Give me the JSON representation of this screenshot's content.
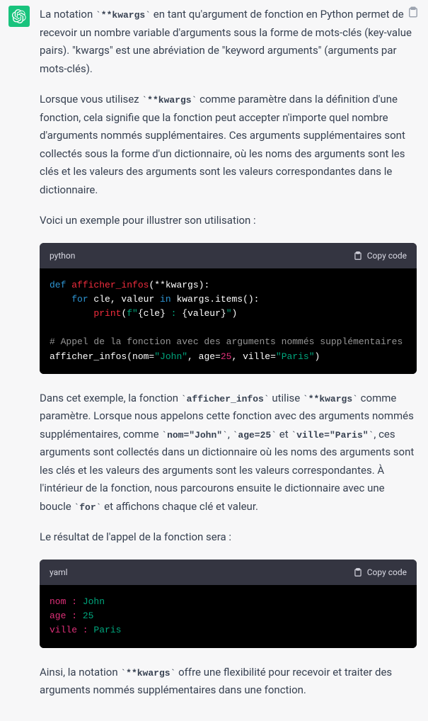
{
  "labels": {
    "lang_python": "python",
    "lang_yaml": "yaml",
    "copy": "Copy code"
  },
  "paragraphs": {
    "p1a": "La notation ",
    "p1c": " en tant qu'argument de fonction en Python permet de recevoir un nombre variable d'arguments sous la forme de mots-clés (key-value pairs). \"kwargs\" est une abréviation de \"keyword arguments\" (arguments par mots-clés).",
    "p2a": "Lorsque vous utilisez ",
    "p2c": " comme paramètre dans la définition d'une fonction, cela signifie que la fonction peut accepter n'importe quel nombre d'arguments nommés supplémentaires. Ces arguments supplémentaires sont collectés sous la forme d'un dictionnaire, où les noms des arguments sont les clés et les valeurs des arguments sont les valeurs correspondantes dans le dictionnaire.",
    "p3": "Voici un exemple pour illustrer son utilisation :",
    "p4a": "Dans cet exemple, la fonction ",
    "p4b": " utilise ",
    "p4c": " comme paramètre. Lorsque nous appelons cette fonction avec des arguments nommés supplémentaires, comme ",
    "p4d": ", ",
    "p4e": " et ",
    "p4f": ", ces arguments sont collectés dans un dictionnaire où les noms des arguments sont les clés et les valeurs des arguments sont les valeurs correspondantes. À l'intérieur de la fonction, nous parcourons ensuite le dictionnaire avec une boucle ",
    "p4g": " et affichons chaque clé et valeur.",
    "p5": "Le résultat de l'appel de la fonction sera :",
    "p6a": "Ainsi, la notation ",
    "p6b": " offre une flexibilité pour recevoir et traiter des arguments nommés supplémentaires dans une fonction."
  },
  "inline": {
    "kwargs": "**kwargs",
    "fn": "afficher_infos",
    "nom": "nom=\"John\"",
    "age": "age=25",
    "ville": "ville=\"Paris\"",
    "for": "for"
  },
  "code1": {
    "l1": {
      "def": "def",
      "name": "afficher_infos",
      "sig": "(**kwargs):"
    },
    "l2": {
      "for": "for",
      "mid": " cle, valeur ",
      "in": "in",
      "tail": " kwargs.items():"
    },
    "l3": {
      "print": "print",
      "open": "(",
      "fpre": "f\"",
      "slice1": "{cle}",
      "sep": " : ",
      "slice2": "{valeur}",
      "fpost": "\"",
      "close": ")"
    },
    "l4": "# Appel de la fonction avec des arguments nommés supplémentaires",
    "l5": {
      "call": "afficher_infos(nom=",
      "s1": "\"John\"",
      "a1": ", age=",
      "n1": "25",
      "a2": ", ville=",
      "s2": "\"Paris\"",
      "end": ")"
    }
  },
  "code2": {
    "r1": {
      "k": "nom :",
      "v": " John"
    },
    "r2": {
      "k": "age :",
      "v": " 25"
    },
    "r3": {
      "k": "ville :",
      "v": " Paris"
    }
  }
}
